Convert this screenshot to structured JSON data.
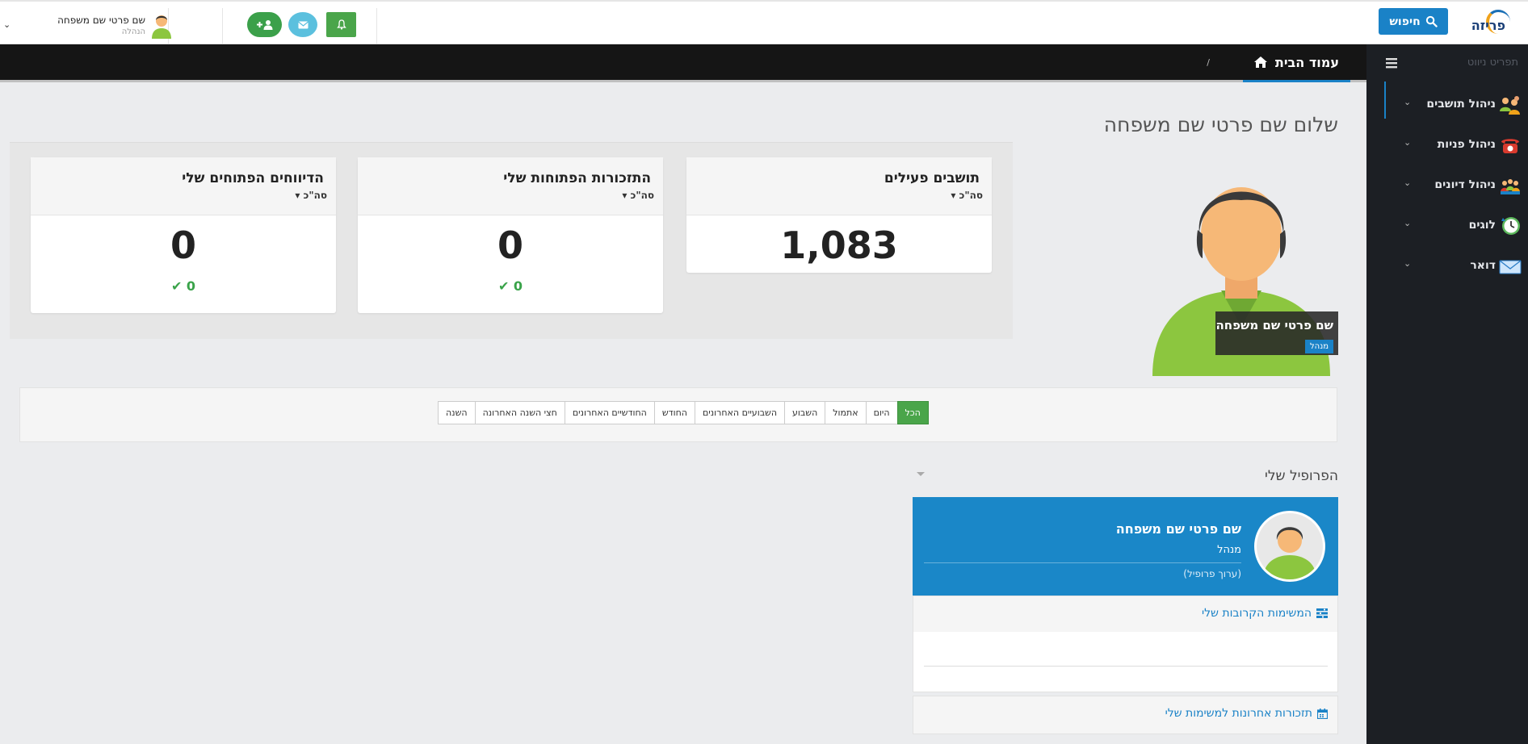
{
  "header": {
    "logo_text": "פריזה",
    "search_label": "חיפוש",
    "user_name": "שם פרטי שם משפחה",
    "user_role": "הנהלה"
  },
  "sidebar": {
    "title": "תפריט ניווט",
    "items": [
      {
        "label": "ניהול תושבים",
        "icon": "residents-icon"
      },
      {
        "label": "ניהול פניות",
        "icon": "phone-icon"
      },
      {
        "label": "ניהול דיונים",
        "icon": "meetings-icon"
      },
      {
        "label": "לוגים",
        "icon": "clock-icon"
      },
      {
        "label": "דואר",
        "icon": "mail-icon"
      }
    ]
  },
  "breadcrumb": {
    "home_label": "עמוד הבית",
    "separator": "/"
  },
  "welcome": {
    "title": "שלום שם פרטי שם משפחה",
    "name": "שם פרטי שם משפחה",
    "role": "מנהל"
  },
  "stats": [
    {
      "title": "תושבים פעילים",
      "subtitle": "סה\"כ",
      "value": "1,083",
      "check": ""
    },
    {
      "title": "התזכורות הפתוחות שלי",
      "subtitle": "סה\"כ",
      "value": "0",
      "check": "0"
    },
    {
      "title": "הדיווחים הפתוחים שלי",
      "subtitle": "סה\"כ",
      "value": "0",
      "check": "0"
    }
  ],
  "filters": {
    "active": "הכל",
    "items": [
      "הכל",
      "היום",
      "אתמול",
      "השבוע",
      "השבועיים האחרונים",
      "החודש",
      "החודשיים האחרונים",
      "חצי השנה האחרונה",
      "השנה"
    ]
  },
  "profile": {
    "heading": "הפרופיל שלי",
    "name": "שם פרטי שם משפחה",
    "role": "מנהל",
    "edit_link": "(ערוך פרופיל)",
    "upcoming_tasks": "המשימות הקרובות שלי",
    "recent_reminders": "תזכורות אחרונות למשימות שלי"
  },
  "colors": {
    "accent": "#1a82c7",
    "success": "#4aa54a",
    "sidebar_bg": "#1c1f24",
    "crumb_bg": "#151515"
  }
}
